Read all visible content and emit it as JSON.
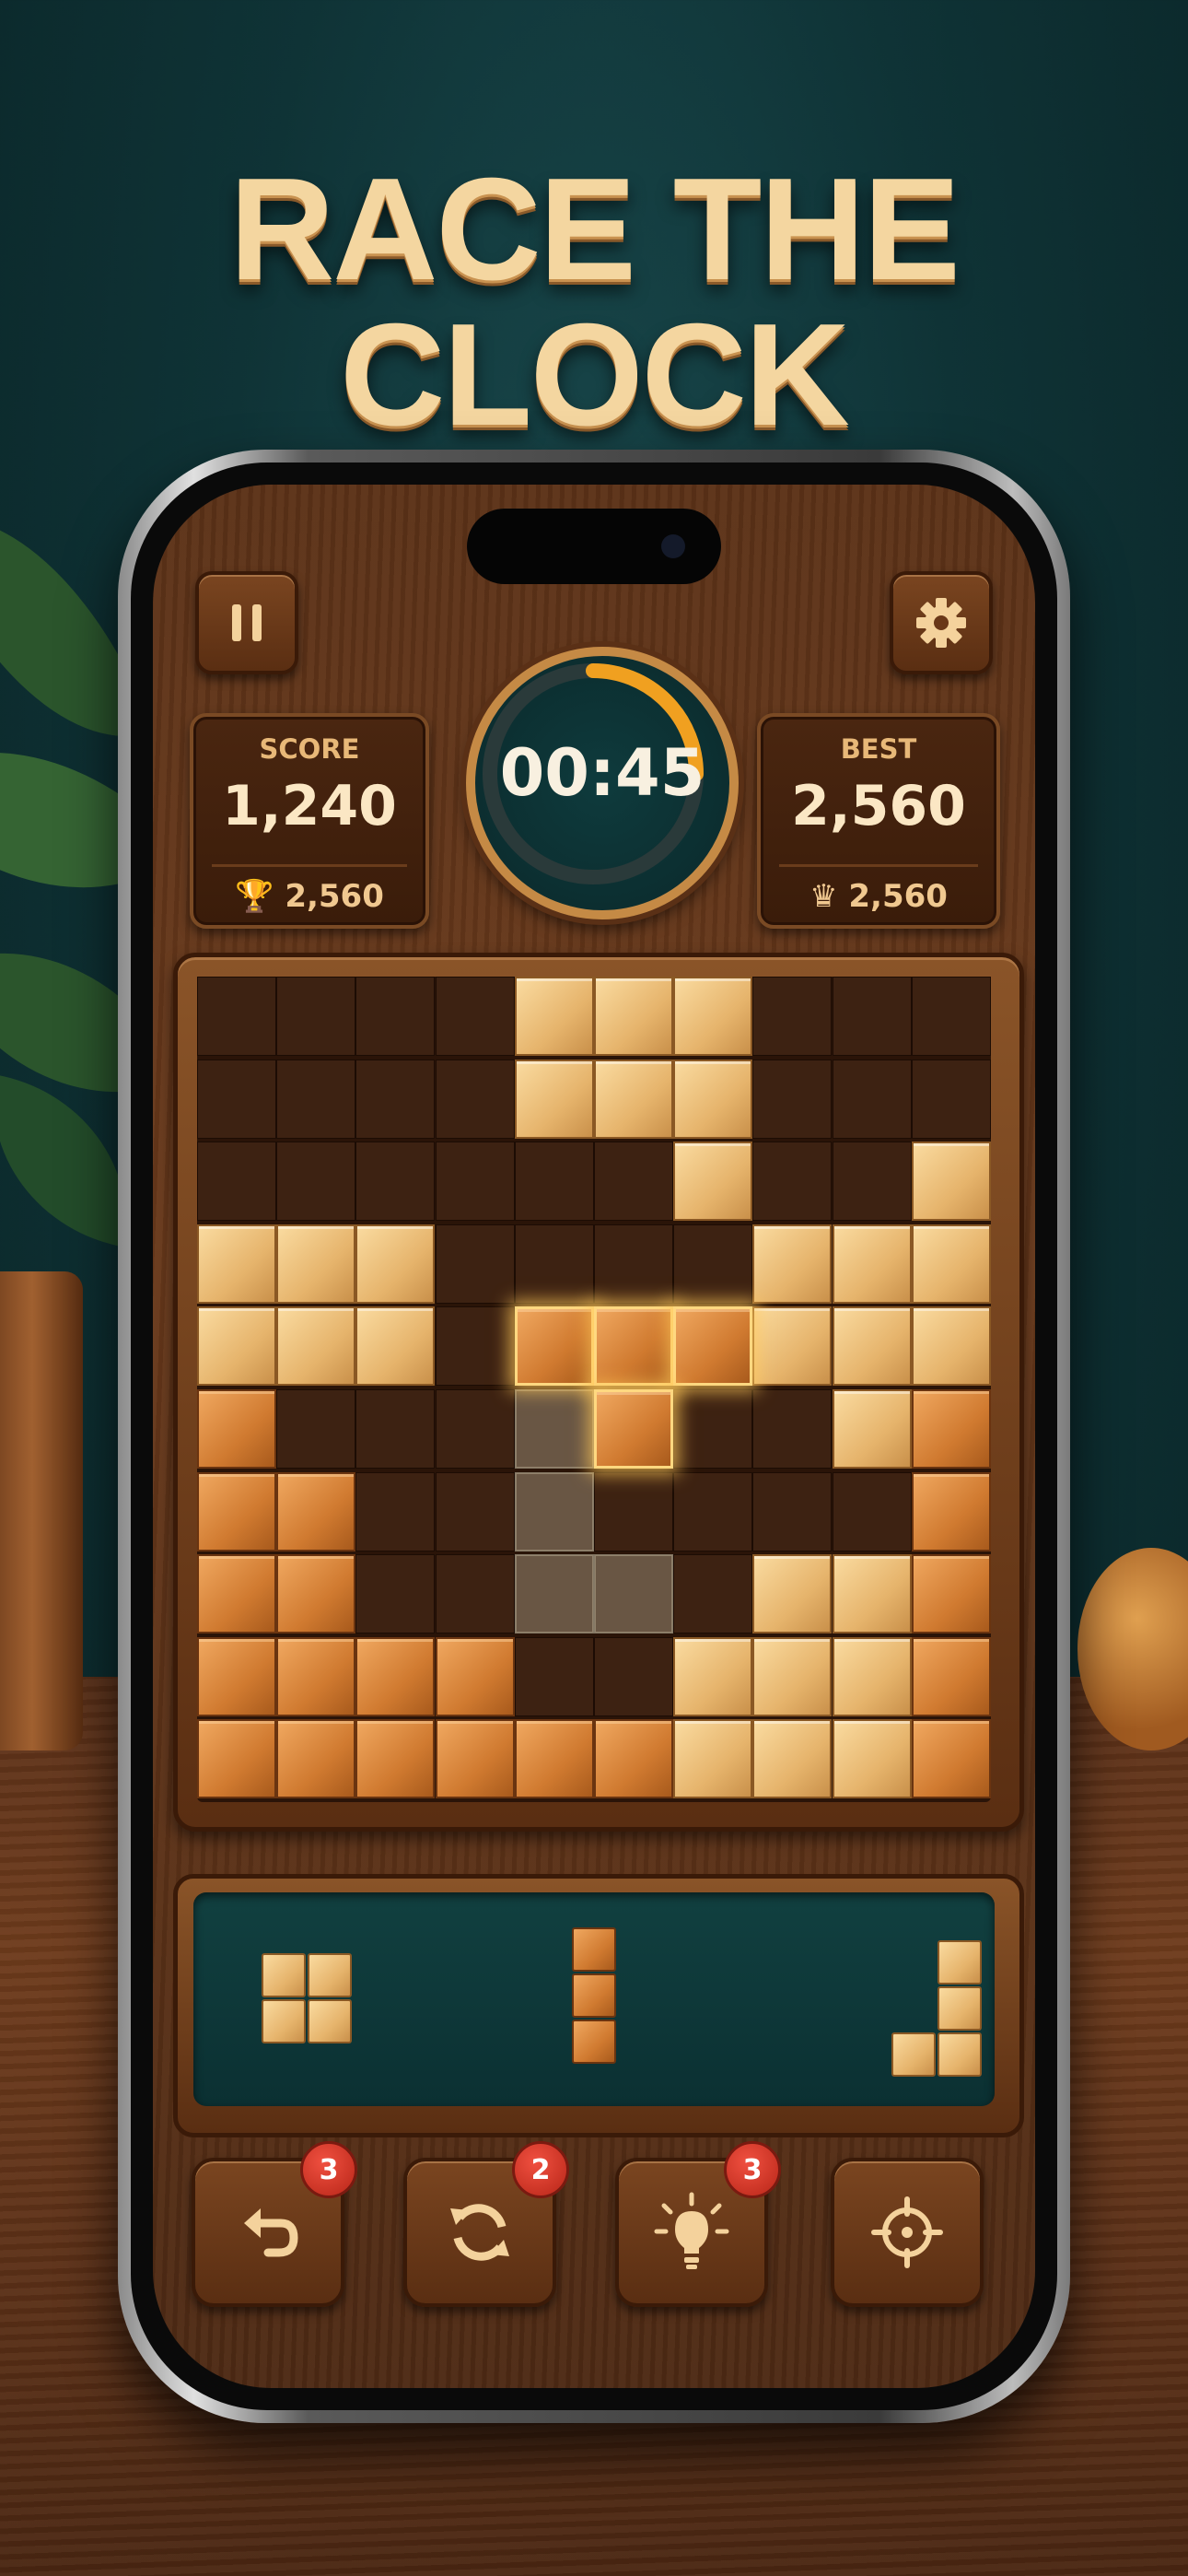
{
  "headline": "RACE THE CLOCK",
  "hud": {
    "pause_icon": "pause-icon",
    "settings_icon": "gear-icon",
    "score": {
      "label": "SCORE",
      "value": "1,240",
      "sub_value": "2,560",
      "sub_icon": "trophy-icon"
    },
    "best": {
      "label": "BEST",
      "value": "2,560",
      "sub_value": "2,560",
      "sub_icon": "crown-icon"
    },
    "timer": {
      "text": "00:45",
      "remaining_fraction": 0.25,
      "ring_color": "#f0a020"
    }
  },
  "board": {
    "size": 10,
    "rows": [
      "....LLL...",
      "....LLL...",
      "......L..L",
      "LLL....LLL",
      "LLL....LLL",
      "O.......LO",
      "OO.......O",
      "OO.....LLO",
      "OOOO..LLLO",
      "OOOOOOLLLO"
    ],
    "legend": {
      "L": "light-block",
      "O": "orange-block",
      ".": "empty"
    },
    "active_piece": {
      "cells": [
        [
          4,
          4
        ],
        [
          4,
          5
        ],
        [
          4,
          6
        ],
        [
          5,
          5
        ]
      ],
      "color": "orange"
    },
    "ghost_cells": [
      [
        5,
        4
      ],
      [
        6,
        4
      ],
      [
        7,
        4
      ],
      [
        7,
        5
      ]
    ]
  },
  "tray": {
    "pieces": [
      {
        "name": "square-2x2",
        "color": "light",
        "cells": [
          [
            0,
            0
          ],
          [
            0,
            1
          ],
          [
            1,
            0
          ],
          [
            1,
            1
          ]
        ]
      },
      {
        "name": "line-3",
        "color": "orange",
        "cells": [
          [
            0,
            0
          ],
          [
            1,
            0
          ],
          [
            2,
            0
          ]
        ]
      },
      {
        "name": "j-piece",
        "color": "light",
        "cells": [
          [
            0,
            1
          ],
          [
            1,
            1
          ],
          [
            2,
            0
          ],
          [
            2,
            1
          ]
        ]
      }
    ]
  },
  "toolbar": [
    {
      "name": "undo",
      "icon": "undo-icon",
      "badge": "3"
    },
    {
      "name": "shuffle",
      "icon": "refresh-icon",
      "badge": "2"
    },
    {
      "name": "hint",
      "icon": "lightbulb-icon",
      "badge": "3"
    },
    {
      "name": "target",
      "icon": "crosshair-icon",
      "badge": ""
    }
  ]
}
